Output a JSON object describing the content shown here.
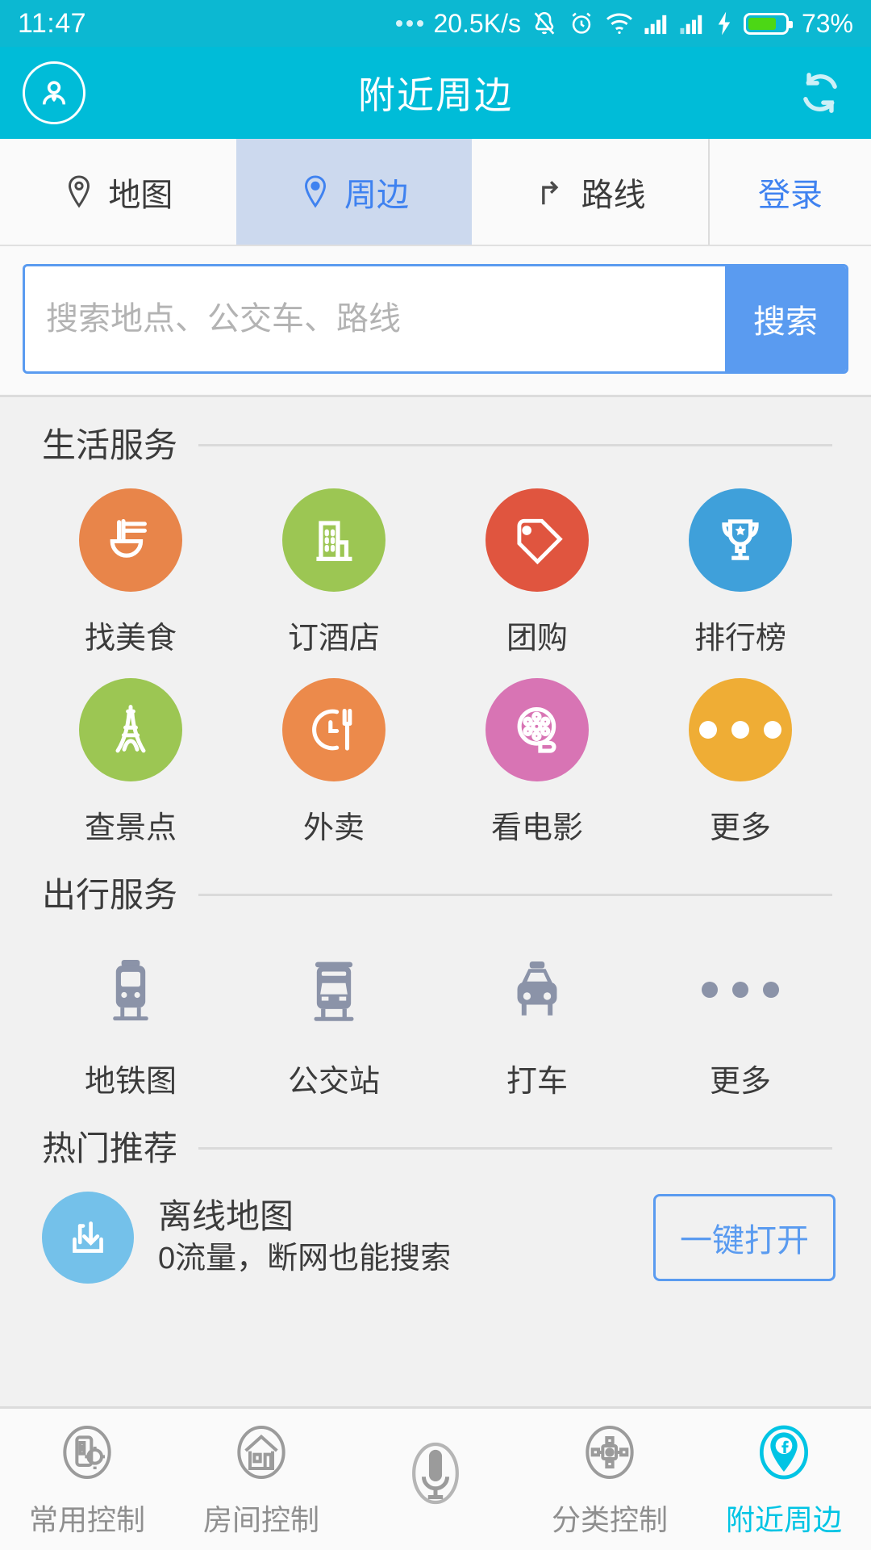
{
  "status_bar": {
    "time": "11:47",
    "network_speed": "20.5K/s",
    "battery_percent": "73%",
    "icons": [
      "more-dots-icon",
      "mute-bell-icon",
      "alarm-clock-icon",
      "wifi-icon",
      "signal-1-icon",
      "signal-2-icon",
      "charging-bolt-icon",
      "battery-icon"
    ]
  },
  "header": {
    "title": "附近周边",
    "avatar_icon": "user-avatar-icon",
    "refresh_icon": "refresh-icon"
  },
  "tabs": [
    {
      "label": "地图",
      "icon": "map-pin-icon",
      "active": false
    },
    {
      "label": "周边",
      "icon": "location-pin-icon",
      "active": true
    },
    {
      "label": "路线",
      "icon": "route-arrow-icon",
      "active": false
    },
    {
      "label": "登录",
      "icon": "",
      "active": false
    }
  ],
  "search": {
    "value": "",
    "placeholder": "搜索地点、公交车、路线",
    "button_label": "搜索"
  },
  "sections": [
    {
      "title": "生活服务",
      "rows": [
        [
          {
            "label": "找美食",
            "icon": "noodle-bowl-icon",
            "color": "#e8854a"
          },
          {
            "label": "订酒店",
            "icon": "hotel-building-icon",
            "color": "#9cc653"
          },
          {
            "label": "团购",
            "icon": "price-tag-icon",
            "color": "#e0553f"
          },
          {
            "label": "排行榜",
            "icon": "trophy-icon",
            "color": "#3fa0da"
          }
        ],
        [
          {
            "label": "查景点",
            "icon": "eiffel-tower-icon",
            "color": "#9cc653"
          },
          {
            "label": "外卖",
            "icon": "clock-fork-icon",
            "color": "#ec8a4b"
          },
          {
            "label": "看电影",
            "icon": "film-reel-icon",
            "color": "#d濾"
          },
          {
            "label": "更多",
            "icon": "more-dots-icon",
            "color": "#efad35"
          }
        ]
      ]
    },
    {
      "title": "出行服务",
      "rows": [
        [
          {
            "label": "地铁图",
            "icon": "subway-train-icon",
            "color": "#8b93a8"
          },
          {
            "label": "公交站",
            "icon": "bus-icon",
            "color": "#8b93a8"
          },
          {
            "label": "打车",
            "icon": "taxi-car-icon",
            "color": "#8b93a8"
          },
          {
            "label": "更多",
            "icon": "more-dots-icon",
            "color": "#8b93a8"
          }
        ]
      ]
    },
    {
      "title": "热门推荐",
      "rows": []
    }
  ],
  "promo": {
    "icon": "offline-download-icon",
    "title": "离线地图",
    "subtitle": "0流量，断网也能搜索",
    "button_label": "一键打开"
  },
  "bottom_nav": [
    {
      "label": "常用控制",
      "icon": "device-settings-icon",
      "active": false
    },
    {
      "label": "房间控制",
      "icon": "home-room-icon",
      "active": false
    },
    {
      "label": "",
      "icon": "microphone-icon",
      "active": false
    },
    {
      "label": "分类控制",
      "icon": "category-nodes-icon",
      "active": false
    },
    {
      "label": "附近周边",
      "icon": "location-f-pin-icon",
      "active": true
    }
  ],
  "colors": {
    "status_bar_bg": "#0cb8d2",
    "header_bg": "#00bcd8",
    "accent_blue": "#5a9bf0",
    "active_tab_bg": "#ccd9ee",
    "active_nav": "#00c4e4",
    "movie_pink": "#d874b4"
  }
}
